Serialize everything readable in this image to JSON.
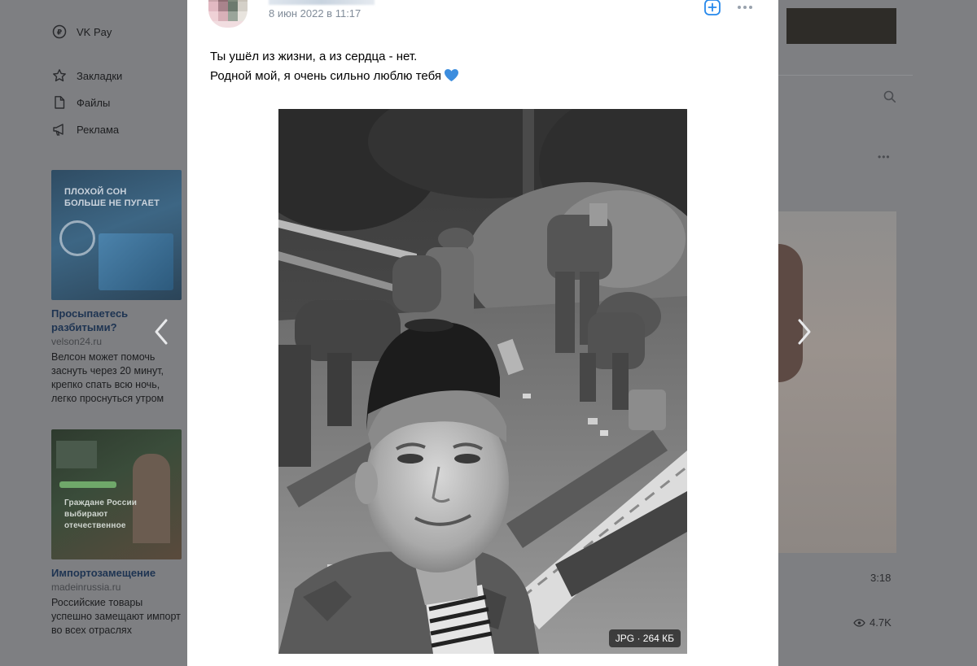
{
  "sidebar": {
    "items": [
      {
        "label": "VK Pay",
        "icon": "vkpay-icon"
      },
      {
        "label": "Закладки",
        "icon": "star-icon"
      },
      {
        "label": "Файлы",
        "icon": "file-icon"
      },
      {
        "label": "Реклама",
        "icon": "megaphone-icon"
      }
    ]
  },
  "ads": [
    {
      "image_text": "ПЛОХОЙ СОН БОЛЬШЕ НЕ ПУГАЕТ",
      "title": "Просыпаетесь разбитыми?",
      "domain": "velson24.ru",
      "text": "Велсон может помочь заснуть через 20 минут, крепко спать всю ночь, легко проснуться утром"
    },
    {
      "image_text": "Граждане России выбирают отечественное",
      "title": "Импортозамещение",
      "domain": "madeinrussia.ru",
      "text": "Российские товары успешно замещают импорт во всех отраслях"
    }
  ],
  "post": {
    "date": "8 июн 2022 в 11:17",
    "text_line1": "Ты ушёл из жизни, а из сердца - нет.",
    "text_line2": "Родной мой, я очень сильно люблю тебя",
    "photo_badge": "JPG · 264 КБ"
  },
  "right": {
    "video_duration": "3:18",
    "views": "4.7K"
  },
  "colors": {
    "overlay": "#7e7f82",
    "card": "#ffffff",
    "date": "#818c99",
    "accent": "#2688eb",
    "heart": "#3c8dde"
  }
}
